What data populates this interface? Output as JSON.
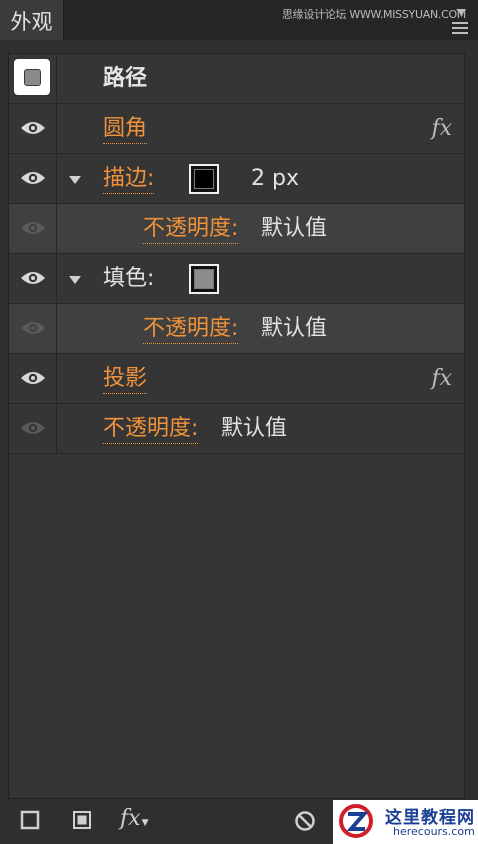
{
  "panel": {
    "tab": "外观",
    "watermark_top": "思缘设计论坛 WWW.MISSYUAN.COM"
  },
  "rows": {
    "path": {
      "label": "路径"
    },
    "rounded": {
      "label": "圆角",
      "fx": "fx"
    },
    "stroke": {
      "label": "描边:",
      "value": "2 px"
    },
    "stroke_opacity": {
      "label": "不透明度:",
      "value": "默认值"
    },
    "fill": {
      "label": "填色:"
    },
    "fill_opacity": {
      "label": "不透明度:",
      "value": "默认值"
    },
    "shadow": {
      "label": "投影",
      "fx": "fx"
    },
    "opacity": {
      "label": "不透明度:",
      "value": "默认值"
    }
  },
  "toolbar": {
    "fx_label": "fx"
  },
  "watermark": {
    "title": "这里教程网",
    "domain": "herecours.com"
  },
  "colors": {
    "accent": "#f0923a",
    "panel_bg": "#353535",
    "sub_row_bg": "#404040"
  },
  "icons": {
    "visibility": "eye-icon",
    "expand": "triangle-down-icon",
    "effect": "fx-icon",
    "clear": "no-entry-icon"
  }
}
